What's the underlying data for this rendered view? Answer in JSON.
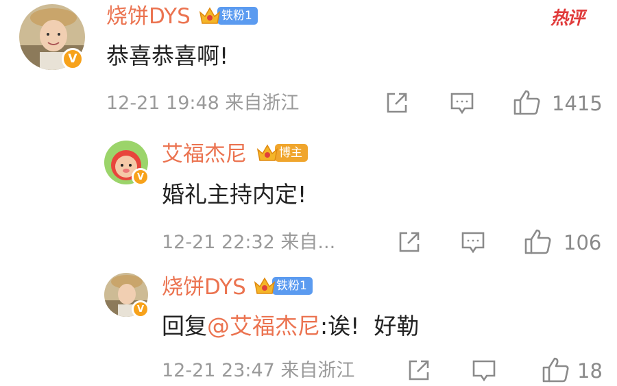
{
  "comments": [
    {
      "username": "烧饼DYS",
      "badge_label": "铁粉1",
      "badge_color": "#5b9bf0",
      "text": "恭喜恭喜啊!",
      "time_location": "12-21 19:48 来自浙江",
      "likes": "1415",
      "hot_label": "热评"
    },
    {
      "username": "艾福杰尼",
      "badge_label": "博主",
      "badge_color": "#f0a52c",
      "text": "婚礼主持内定!",
      "time_location": "12-21 22:32 来自...",
      "likes": "106"
    },
    {
      "username": "烧饼DYS",
      "badge_label": "铁粉1",
      "badge_color": "#5b9bf0",
      "reply_prefix": "回复",
      "mention": "@艾福杰尼",
      "reply_text": ":诶!  好勒",
      "time_location": "12-21 23:47 来自浙江",
      "likes": "18"
    }
  ],
  "colors": {
    "username": "#eb7350",
    "verified_badge": "#f7a21b",
    "meta_text": "#9a9a9a",
    "hot": "#e03a3a"
  },
  "icons": [
    "verified-v-icon",
    "crown-icon",
    "share-icon",
    "comment-icon",
    "like-thumb-icon"
  ]
}
